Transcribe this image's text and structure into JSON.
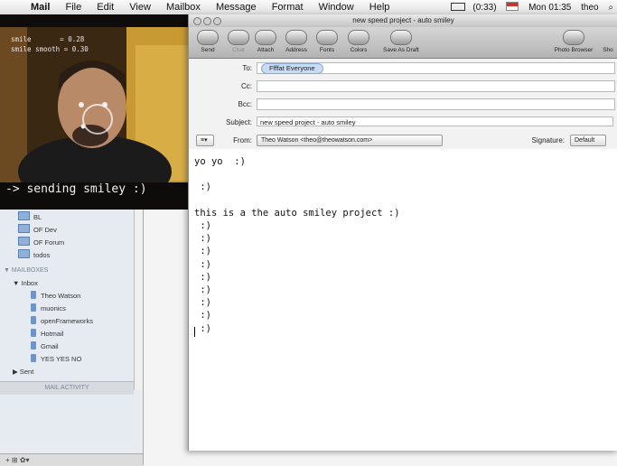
{
  "menubar": {
    "apple": "",
    "app": "Mail",
    "menus": [
      "File",
      "Edit",
      "View",
      "Mailbox",
      "Message",
      "Format",
      "Window",
      "Help"
    ],
    "battery": "(0:33)",
    "clock": "Mon 01:35",
    "user": "theo"
  },
  "left": {
    "dots": "○ ○ ○",
    "folders": [
      {
        "label": "BL"
      },
      {
        "label": "OF Dev"
      },
      {
        "label": "OF Forum"
      },
      {
        "label": "todos"
      }
    ],
    "mailboxes_header": "▼ MAILBOXES",
    "inbox": "▼ Inbox",
    "inbox_items": [
      "Theo Watson",
      "muonics",
      "openFrameworks",
      "Hotmail",
      "Gmail",
      "YES YES NO"
    ],
    "sent": "▶ Sent",
    "activity": "MAIL ACTIVITY",
    "bottom": "+   ⊞   ✿▾"
  },
  "cam": {
    "readout": "smile       = 0.28\nsmile smooth = 0.30",
    "sending": "-> sending smiley :)"
  },
  "compose": {
    "title": "new speed project - auto smiley",
    "toolbar": {
      "send": "Send",
      "chat": "Chat",
      "attach": "Attach",
      "address": "Address",
      "fonts": "Fonts",
      "colors": "Colors",
      "save_draft": "Save As Draft",
      "photo_browser": "Photo Browser",
      "show": "Sho"
    },
    "labels": {
      "to": "To:",
      "cc": "Cc:",
      "bcc": "Bcc:",
      "subject": "Subject:",
      "from": "From:",
      "signature": "Signature:"
    },
    "to_token": "Ffffat Everyone",
    "subject": "new speed project - auto smiley",
    "from": "Theo Watson <theo@theowatson.com>",
    "signature": "Default",
    "account_menu": "≡▾",
    "body": "yo yo  :)\n\n :)\n\nthis is a the auto smiley project :)\n :)\n :)\n :)\n :)\n :)\n :)\n :)\n :)\n :)"
  }
}
